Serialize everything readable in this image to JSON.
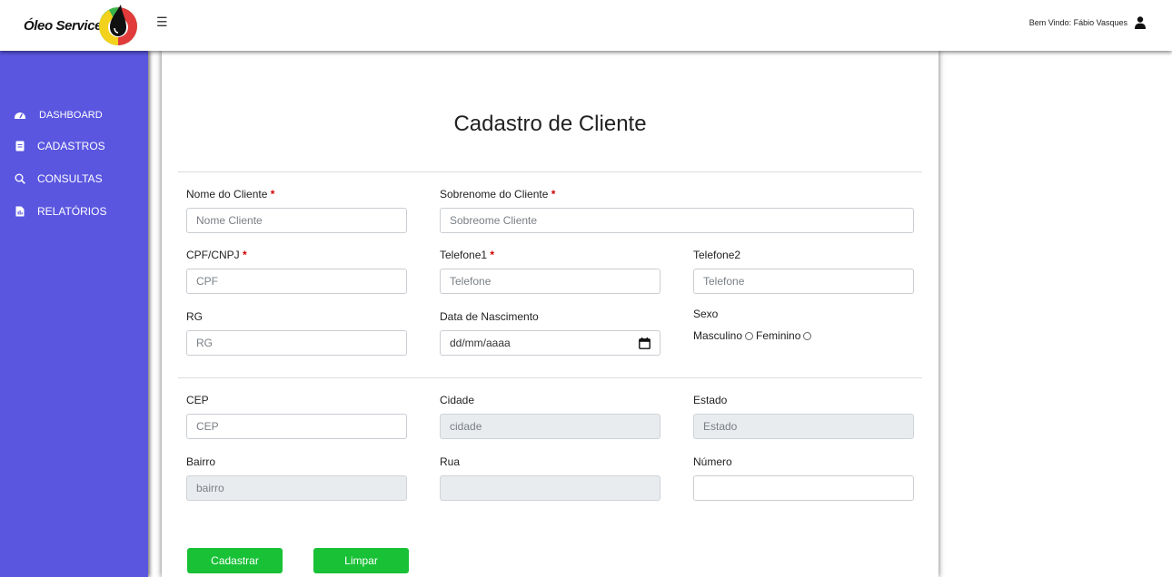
{
  "header": {
    "brand": "Óleo Service",
    "menu_icon": "☰",
    "welcome": "Bem Vindo: Fábio Vasques",
    "brand_colors": [
      "#f2d21c",
      "#e23b3b",
      "#3ab54a",
      "#111111"
    ]
  },
  "sidebar": {
    "background": "#5a56e0",
    "items": [
      {
        "label": "DASHBOARD",
        "icon": "dashboard-icon"
      },
      {
        "label": "CADASTROS",
        "icon": "document-icon"
      },
      {
        "label": "CONSULTAS",
        "icon": "search-icon"
      },
      {
        "label": "RELATÓRIOS",
        "icon": "report-icon"
      }
    ]
  },
  "form": {
    "title": "Cadastro de Cliente",
    "required_mark": "*",
    "nome": {
      "label": "Nome do Cliente",
      "placeholder": "Nome Cliente"
    },
    "sobrenome": {
      "label": "Sobrenome do Cliente",
      "placeholder": "Sobreome Cliente"
    },
    "cpf": {
      "label": "CPF/CNPJ",
      "placeholder": "CPF"
    },
    "telefone1": {
      "label": "Telefone1",
      "placeholder": "Telefone"
    },
    "telefone2": {
      "label": "Telefone2",
      "placeholder": "Telefone"
    },
    "rg": {
      "label": "RG",
      "placeholder": "RG"
    },
    "nascimento": {
      "label": "Data de Nascimento",
      "placeholder": "dd/mm/aaaa"
    },
    "sexo": {
      "label": "Sexo",
      "option_male": "Masculino",
      "option_female": "Feminino"
    },
    "cep": {
      "label": "CEP",
      "placeholder": "CEP"
    },
    "cidade": {
      "label": "Cidade",
      "placeholder": "cidade"
    },
    "estado": {
      "label": "Estado",
      "placeholder": "Estado"
    },
    "bairro": {
      "label": "Bairro",
      "placeholder": "bairro"
    },
    "rua": {
      "label": "Rua",
      "placeholder": ""
    },
    "numero": {
      "label": "Número",
      "placeholder": ""
    },
    "buttons": {
      "submit": "Cadastrar",
      "clear": "Limpar",
      "color": "#18c136"
    }
  }
}
